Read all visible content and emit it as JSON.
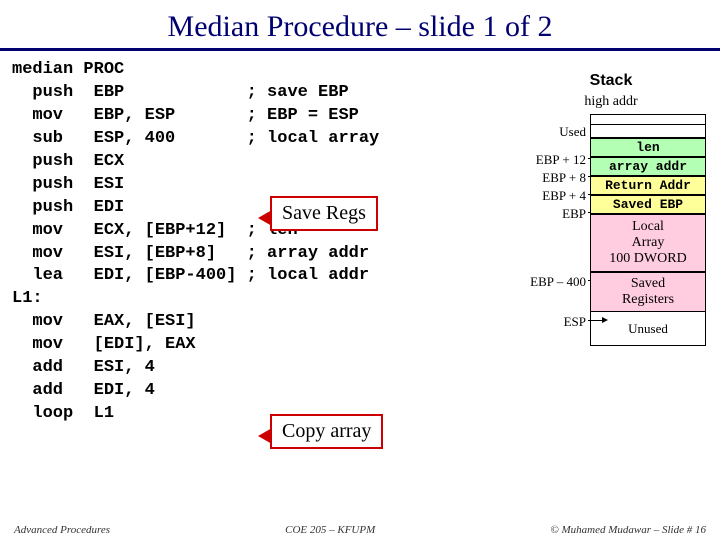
{
  "title": "Median Procedure – slide 1 of 2",
  "code": "median PROC\n  push  EBP            ; save EBP\n  mov   EBP, ESP       ; EBP = ESP\n  sub   ESP, 400       ; local array\n  push  ECX\n  push  ESI\n  push  EDI\n  mov   ECX, [EBP+12]  ; len\n  mov   ESI, [EBP+8]   ; array addr\n  lea   EDI, [EBP-400] ; local addr\nL1:\n  mov   EAX, [ESI]\n  mov   [EDI], EAX\n  add   ESI, 4\n  add   EDI, 4\n  loop  L1",
  "box1": "Save Regs",
  "box2": "Copy array",
  "stack": {
    "title": "Stack",
    "high": "high addr",
    "used": "Used",
    "labels": {
      "l12": "EBP + 12",
      "l8": "EBP + 8",
      "l4": "EBP + 4",
      "lebp": "EBP",
      "lm400": "EBP – 400",
      "lesp": "ESP"
    },
    "cells": {
      "len": "len",
      "arrayaddr": "array addr",
      "retaddr": "Return Addr",
      "savedebp": "Saved EBP",
      "local1": "Local",
      "local2": "Array",
      "local3": "100 DWORD",
      "savedregs1": "Saved",
      "savedregs2": "Registers",
      "unused": "Unused"
    }
  },
  "footer": {
    "left": "Advanced Procedures",
    "mid": "COE 205 – KFUPM",
    "right": "© Muhamed Mudawar – Slide # 16"
  }
}
